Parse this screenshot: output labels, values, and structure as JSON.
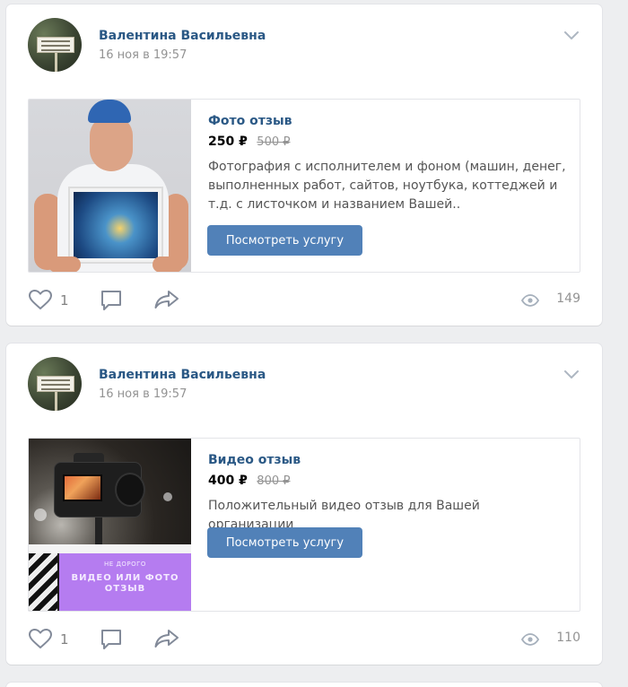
{
  "posts": [
    {
      "author": "Валентина Васильевна",
      "date": "16 ноя в 19:57",
      "product": {
        "title": "Фото отзыв",
        "price": "250 ₽",
        "old_price": "500 ₽",
        "description": "Фотография с исполнителем и фоном (машин, денег, выполненных работ, сайтов, ноутбука, коттеджей и т.д. с листочком и названием Вашей..",
        "button_label": "Посмотреть услугу"
      },
      "likes": "1",
      "views": "149"
    },
    {
      "author": "Валентина Васильевна",
      "date": "16 ноя в 19:57",
      "product": {
        "title": "Видео отзыв",
        "price": "400 ₽",
        "old_price": "800 ₽",
        "description": "Положительный видео отзыв для Вашей организации",
        "button_label": "Посмотреть услугу",
        "image_caption_small": "НЕ ДОРОГО",
        "image_caption_big": "ВИДЕО ИЛИ ФОТО ОТЗЫВ"
      },
      "likes": "1",
      "views": "110"
    }
  ],
  "icons": {
    "like": "heart-icon",
    "comment": "comment-icon",
    "share": "share-icon",
    "views": "eye-icon",
    "menu": "chevron-down-icon"
  },
  "colors": {
    "page_background": "#edeef0",
    "link_blue": "#2a5885",
    "button_blue": "#5181b8",
    "muted_gray": "#939393",
    "icon_gray": "#828a99"
  }
}
